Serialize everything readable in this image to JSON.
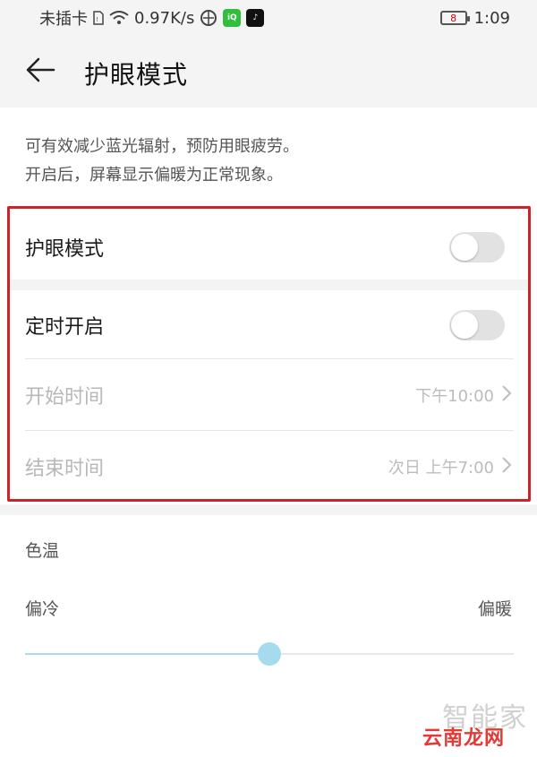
{
  "status_bar": {
    "carrier": "未插卡",
    "net_speed": "0.97K/s",
    "battery_level": "8",
    "time": "1:09",
    "icons": [
      "sim-icon",
      "wifi-icon",
      "vpn-icon",
      "iqiyi-app-icon",
      "tiktok-app-icon"
    ]
  },
  "header": {
    "title": "护眼模式",
    "back_icon": "arrow-left-icon"
  },
  "description": {
    "line1": "可有效减少蓝光辐射，预防用眼疲劳。",
    "line2": "开启后，屏幕显示偏暖为正常现象。"
  },
  "settings": {
    "eye_mode": {
      "label": "护眼模式",
      "enabled": false
    },
    "schedule": {
      "label": "定时开启",
      "enabled": false
    },
    "start_time": {
      "label": "开始时间",
      "value": "下午10:00"
    },
    "end_time": {
      "label": "结束时间",
      "value": "次日 上午7:00"
    }
  },
  "color_temperature": {
    "label": "色温",
    "cold_label": "偏冷",
    "warm_label": "偏暖",
    "level_fraction": 0.5
  },
  "watermark": {
    "top": "智能家",
    "bottom": "云南龙网"
  },
  "colors": {
    "highlight_border": "#c9242b",
    "slider_accent": "#a6dbee",
    "toggle_off": "#e2e2e2"
  }
}
